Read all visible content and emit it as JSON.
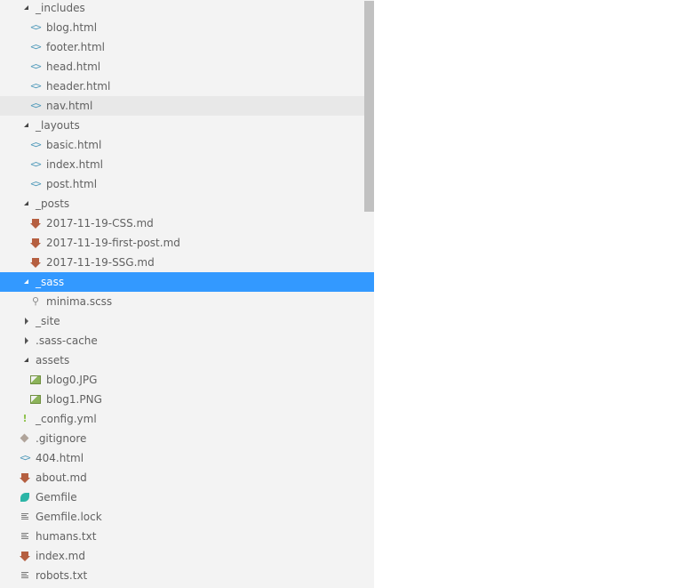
{
  "explorer": {
    "rows": [
      {
        "label": "_includes",
        "type": "folder",
        "state": "open",
        "depth": 1,
        "icon": "none"
      },
      {
        "label": "blog.html",
        "type": "file",
        "depth": 2,
        "icon": "html-code-icon"
      },
      {
        "label": "footer.html",
        "type": "file",
        "depth": 2,
        "icon": "html-code-icon"
      },
      {
        "label": "head.html",
        "type": "file",
        "depth": 2,
        "icon": "html-code-icon"
      },
      {
        "label": "header.html",
        "type": "file",
        "depth": 2,
        "icon": "html-code-icon"
      },
      {
        "label": "nav.html",
        "type": "file",
        "depth": 2,
        "icon": "html-code-icon",
        "hover": true
      },
      {
        "label": "_layouts",
        "type": "folder",
        "state": "open",
        "depth": 1,
        "icon": "none"
      },
      {
        "label": "basic.html",
        "type": "file",
        "depth": 2,
        "icon": "html-code-icon"
      },
      {
        "label": "index.html",
        "type": "file",
        "depth": 2,
        "icon": "html-code-icon"
      },
      {
        "label": "post.html",
        "type": "file",
        "depth": 2,
        "icon": "html-code-icon"
      },
      {
        "label": "_posts",
        "type": "folder",
        "state": "open",
        "depth": 1,
        "icon": "none"
      },
      {
        "label": "2017-11-19-CSS.md",
        "type": "file",
        "depth": 2,
        "icon": "markdown-arrow-icon"
      },
      {
        "label": "2017-11-19-first-post.md",
        "type": "file",
        "depth": 2,
        "icon": "markdown-arrow-icon"
      },
      {
        "label": "2017-11-19-SSG.md",
        "type": "file",
        "depth": 2,
        "icon": "markdown-arrow-icon"
      },
      {
        "label": "_sass",
        "type": "folder",
        "state": "open",
        "depth": 1,
        "icon": "none",
        "selected": true
      },
      {
        "label": "minima.scss",
        "type": "file",
        "depth": 2,
        "icon": "sass-icon"
      },
      {
        "label": "_site",
        "type": "folder",
        "state": "closed",
        "depth": 1,
        "icon": "none"
      },
      {
        "label": ".sass-cache",
        "type": "folder",
        "state": "closed",
        "depth": 1,
        "icon": "none"
      },
      {
        "label": "assets",
        "type": "folder",
        "state": "open",
        "depth": 1,
        "icon": "none"
      },
      {
        "label": "blog0.JPG",
        "type": "file",
        "depth": 2,
        "icon": "image-icon"
      },
      {
        "label": "blog1.PNG",
        "type": "file",
        "depth": 2,
        "icon": "image-icon"
      },
      {
        "label": "_config.yml",
        "type": "file",
        "depth": 1,
        "icon": "yaml-exclamation-icon"
      },
      {
        "label": ".gitignore",
        "type": "file",
        "depth": 1,
        "icon": "git-diamond-icon"
      },
      {
        "label": "404.html",
        "type": "file",
        "depth": 1,
        "icon": "html-code-icon"
      },
      {
        "label": "about.md",
        "type": "file",
        "depth": 1,
        "icon": "markdown-arrow-icon"
      },
      {
        "label": "Gemfile",
        "type": "file",
        "depth": 1,
        "icon": "gem-icon"
      },
      {
        "label": "Gemfile.lock",
        "type": "file",
        "depth": 1,
        "icon": "text-lines-icon"
      },
      {
        "label": "humans.txt",
        "type": "file",
        "depth": 1,
        "icon": "text-lines-icon"
      },
      {
        "label": "index.md",
        "type": "file",
        "depth": 1,
        "icon": "markdown-arrow-icon"
      },
      {
        "label": "robots.txt",
        "type": "file",
        "depth": 1,
        "icon": "text-lines-icon"
      }
    ]
  },
  "colors": {
    "sidebar_bg": "#f3f3f3",
    "selected_bg": "#3399ff",
    "hover_bg": "#e8e8e8",
    "text": "#616161",
    "html_icon": "#519aba",
    "markdown_icon": "#b55f40",
    "gem_icon": "#2cb5a6",
    "yaml_icon": "#8dc149"
  }
}
